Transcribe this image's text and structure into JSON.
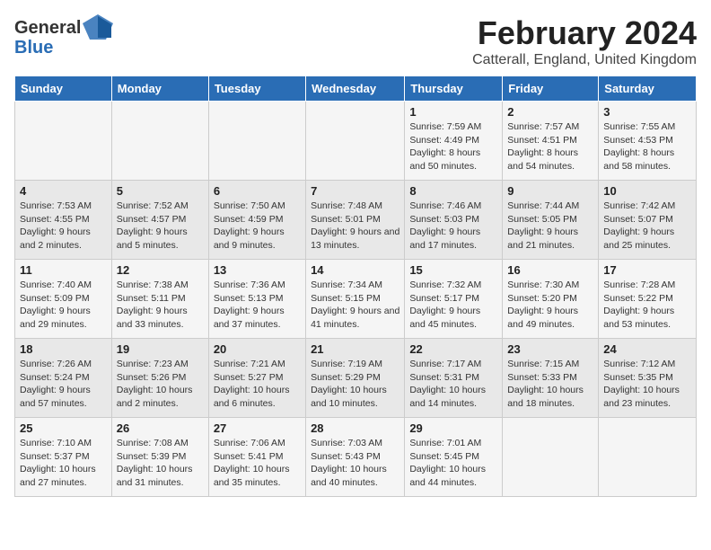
{
  "header": {
    "logo_line1": "General",
    "logo_line2": "Blue",
    "title": "February 2024",
    "subtitle": "Catterall, England, United Kingdom"
  },
  "days_of_week": [
    "Sunday",
    "Monday",
    "Tuesday",
    "Wednesday",
    "Thursday",
    "Friday",
    "Saturday"
  ],
  "weeks": [
    [
      {
        "day": "",
        "info": ""
      },
      {
        "day": "",
        "info": ""
      },
      {
        "day": "",
        "info": ""
      },
      {
        "day": "",
        "info": ""
      },
      {
        "day": "1",
        "info": "Sunrise: 7:59 AM\nSunset: 4:49 PM\nDaylight: 8 hours and 50 minutes."
      },
      {
        "day": "2",
        "info": "Sunrise: 7:57 AM\nSunset: 4:51 PM\nDaylight: 8 hours and 54 minutes."
      },
      {
        "day": "3",
        "info": "Sunrise: 7:55 AM\nSunset: 4:53 PM\nDaylight: 8 hours and 58 minutes."
      }
    ],
    [
      {
        "day": "4",
        "info": "Sunrise: 7:53 AM\nSunset: 4:55 PM\nDaylight: 9 hours and 2 minutes."
      },
      {
        "day": "5",
        "info": "Sunrise: 7:52 AM\nSunset: 4:57 PM\nDaylight: 9 hours and 5 minutes."
      },
      {
        "day": "6",
        "info": "Sunrise: 7:50 AM\nSunset: 4:59 PM\nDaylight: 9 hours and 9 minutes."
      },
      {
        "day": "7",
        "info": "Sunrise: 7:48 AM\nSunset: 5:01 PM\nDaylight: 9 hours and 13 minutes."
      },
      {
        "day": "8",
        "info": "Sunrise: 7:46 AM\nSunset: 5:03 PM\nDaylight: 9 hours and 17 minutes."
      },
      {
        "day": "9",
        "info": "Sunrise: 7:44 AM\nSunset: 5:05 PM\nDaylight: 9 hours and 21 minutes."
      },
      {
        "day": "10",
        "info": "Sunrise: 7:42 AM\nSunset: 5:07 PM\nDaylight: 9 hours and 25 minutes."
      }
    ],
    [
      {
        "day": "11",
        "info": "Sunrise: 7:40 AM\nSunset: 5:09 PM\nDaylight: 9 hours and 29 minutes."
      },
      {
        "day": "12",
        "info": "Sunrise: 7:38 AM\nSunset: 5:11 PM\nDaylight: 9 hours and 33 minutes."
      },
      {
        "day": "13",
        "info": "Sunrise: 7:36 AM\nSunset: 5:13 PM\nDaylight: 9 hours and 37 minutes."
      },
      {
        "day": "14",
        "info": "Sunrise: 7:34 AM\nSunset: 5:15 PM\nDaylight: 9 hours and 41 minutes."
      },
      {
        "day": "15",
        "info": "Sunrise: 7:32 AM\nSunset: 5:17 PM\nDaylight: 9 hours and 45 minutes."
      },
      {
        "day": "16",
        "info": "Sunrise: 7:30 AM\nSunset: 5:20 PM\nDaylight: 9 hours and 49 minutes."
      },
      {
        "day": "17",
        "info": "Sunrise: 7:28 AM\nSunset: 5:22 PM\nDaylight: 9 hours and 53 minutes."
      }
    ],
    [
      {
        "day": "18",
        "info": "Sunrise: 7:26 AM\nSunset: 5:24 PM\nDaylight: 9 hours and 57 minutes."
      },
      {
        "day": "19",
        "info": "Sunrise: 7:23 AM\nSunset: 5:26 PM\nDaylight: 10 hours and 2 minutes."
      },
      {
        "day": "20",
        "info": "Sunrise: 7:21 AM\nSunset: 5:27 PM\nDaylight: 10 hours and 6 minutes."
      },
      {
        "day": "21",
        "info": "Sunrise: 7:19 AM\nSunset: 5:29 PM\nDaylight: 10 hours and 10 minutes."
      },
      {
        "day": "22",
        "info": "Sunrise: 7:17 AM\nSunset: 5:31 PM\nDaylight: 10 hours and 14 minutes."
      },
      {
        "day": "23",
        "info": "Sunrise: 7:15 AM\nSunset: 5:33 PM\nDaylight: 10 hours and 18 minutes."
      },
      {
        "day": "24",
        "info": "Sunrise: 7:12 AM\nSunset: 5:35 PM\nDaylight: 10 hours and 23 minutes."
      }
    ],
    [
      {
        "day": "25",
        "info": "Sunrise: 7:10 AM\nSunset: 5:37 PM\nDaylight: 10 hours and 27 minutes."
      },
      {
        "day": "26",
        "info": "Sunrise: 7:08 AM\nSunset: 5:39 PM\nDaylight: 10 hours and 31 minutes."
      },
      {
        "day": "27",
        "info": "Sunrise: 7:06 AM\nSunset: 5:41 PM\nDaylight: 10 hours and 35 minutes."
      },
      {
        "day": "28",
        "info": "Sunrise: 7:03 AM\nSunset: 5:43 PM\nDaylight: 10 hours and 40 minutes."
      },
      {
        "day": "29",
        "info": "Sunrise: 7:01 AM\nSunset: 5:45 PM\nDaylight: 10 hours and 44 minutes."
      },
      {
        "day": "",
        "info": ""
      },
      {
        "day": "",
        "info": ""
      }
    ]
  ]
}
